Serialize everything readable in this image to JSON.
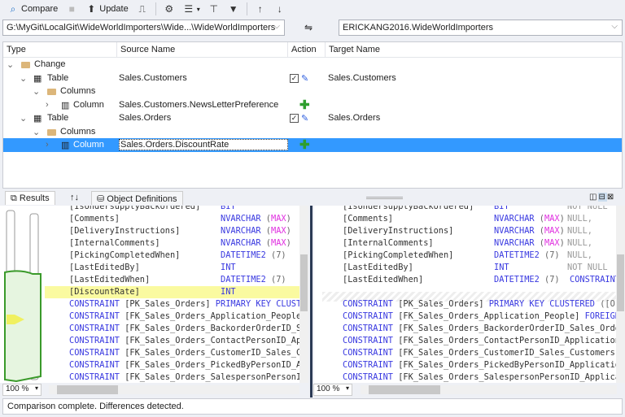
{
  "toolbar": {
    "compare": "Compare",
    "update": "Update"
  },
  "source_path": "G:\\MyGit\\LocalGit\\WideWorldImporters\\Wide...\\WideWorldImporters",
  "target_db": "ERICKANG2016.WideWorldImporters",
  "grid": {
    "headers": [
      "Type",
      "Source Name",
      "Action",
      "Target Name"
    ],
    "rows": [
      {
        "level": 0,
        "expander": "⌄",
        "icon": "folder",
        "type": "Change",
        "source": "",
        "action": "",
        "target": ""
      },
      {
        "level": 1,
        "expander": "⌄",
        "icon": "table",
        "type": "Table",
        "source": "Sales.Customers",
        "action": "edit",
        "target": "Sales.Customers"
      },
      {
        "level": 2,
        "expander": "⌄",
        "icon": "folder",
        "type": "Columns",
        "source": "",
        "action": "",
        "target": ""
      },
      {
        "level": 3,
        "expander": "›",
        "icon": "column",
        "type": "Column",
        "source": "Sales.Customers.NewsLetterPreference",
        "action": "add",
        "target": ""
      },
      {
        "level": 1,
        "expander": "⌄",
        "icon": "table",
        "type": "Table",
        "source": "Sales.Orders",
        "action": "edit",
        "target": "Sales.Orders"
      },
      {
        "level": 2,
        "expander": "⌄",
        "icon": "folder",
        "type": "Columns",
        "source": "",
        "action": "",
        "target": ""
      },
      {
        "level": 3,
        "expander": "›",
        "icon": "column",
        "type": "Column",
        "source": "Sales.Orders.DiscountRate",
        "action": "add",
        "target": "",
        "selected": true
      }
    ]
  },
  "tabs": {
    "results": "Results",
    "sort": "↑↓",
    "object_definitions": "Object Definitions"
  },
  "source_code": [
    [
      [
        "n",
        "[IsUndersupplyBackordered]"
      ],
      [
        "k",
        "BIT"
      ]
    ],
    [
      [
        "n",
        "[Comments]"
      ],
      [
        "k",
        "NVARCHAR "
      ],
      [
        "p",
        "("
      ],
      [
        "m",
        "MAX"
      ],
      [
        "p",
        ")"
      ]
    ],
    [
      [
        "n",
        "[DeliveryInstructions]"
      ],
      [
        "k",
        "NVARCHAR "
      ],
      [
        "p",
        "("
      ],
      [
        "m",
        "MAX"
      ],
      [
        "p",
        ")"
      ]
    ],
    [
      [
        "n",
        "[InternalComments]"
      ],
      [
        "k",
        "NVARCHAR "
      ],
      [
        "p",
        "("
      ],
      [
        "m",
        "MAX"
      ],
      [
        "p",
        ")"
      ]
    ],
    [
      [
        "n",
        "[PickingCompletedWhen]"
      ],
      [
        "k",
        "DATETIME2 "
      ],
      [
        "p",
        "(7)"
      ]
    ],
    [
      [
        "n",
        "[LastEditedBy]"
      ],
      [
        "k",
        "INT"
      ]
    ],
    [
      [
        "n",
        "[LastEditedWhen]"
      ],
      [
        "k",
        "DATETIME2 "
      ],
      [
        "p",
        "(7)"
      ]
    ],
    [
      [
        "n",
        "[DiscountRate]"
      ],
      [
        "k",
        "INT"
      ]
    ],
    [
      [
        "k",
        "CONSTRAINT "
      ],
      [
        "n",
        "[PK_Sales_Orders] "
      ],
      [
        "k",
        "PRIMARY KEY CLUSTERED"
      ]
    ],
    [
      [
        "k",
        "CONSTRAINT "
      ],
      [
        "n",
        "[FK_Sales_Orders_Application_People]"
      ]
    ],
    [
      [
        "k",
        "CONSTRAINT "
      ],
      [
        "n",
        "[FK_Sales_Orders_BackorderOrderID_Sales_Orders]"
      ]
    ],
    [
      [
        "k",
        "CONSTRAINT "
      ],
      [
        "n",
        "[FK_Sales_Orders_ContactPersonID_Application]"
      ]
    ],
    [
      [
        "k",
        "CONSTRAINT "
      ],
      [
        "n",
        "[FK_Sales_Orders_CustomerID_Sales_Customers]"
      ]
    ],
    [
      [
        "k",
        "CONSTRAINT "
      ],
      [
        "n",
        "[FK_Sales_Orders_PickedByPersonID_Application]"
      ]
    ],
    [
      [
        "k",
        "CONSTRAINT "
      ],
      [
        "n",
        "[FK_Sales_Orders_SalespersonPersonID_Application]"
      ]
    ]
  ],
  "target_code": [
    [
      [
        "n",
        "[IsUndersupplyBackordered]"
      ],
      [
        "k",
        "BIT"
      ],
      [
        "g",
        "NOT NULL"
      ]
    ],
    [
      [
        "n",
        "[Comments]"
      ],
      [
        "k",
        "NVARCHAR "
      ],
      [
        "p",
        "("
      ],
      [
        "m",
        "MAX"
      ],
      [
        "p",
        ") "
      ],
      [
        "g",
        "NULL,"
      ]
    ],
    [
      [
        "n",
        "[DeliveryInstructions]"
      ],
      [
        "k",
        "NVARCHAR "
      ],
      [
        "p",
        "("
      ],
      [
        "m",
        "MAX"
      ],
      [
        "p",
        ") "
      ],
      [
        "g",
        "NULL,"
      ]
    ],
    [
      [
        "n",
        "[InternalComments]"
      ],
      [
        "k",
        "NVARCHAR "
      ],
      [
        "p",
        "("
      ],
      [
        "m",
        "MAX"
      ],
      [
        "p",
        ") "
      ],
      [
        "g",
        "NULL,"
      ]
    ],
    [
      [
        "n",
        "[PickingCompletedWhen]"
      ],
      [
        "k",
        "DATETIME2 "
      ],
      [
        "p",
        "(7)  "
      ],
      [
        "g",
        "NULL,"
      ]
    ],
    [
      [
        "n",
        "[LastEditedBy]"
      ],
      [
        "k",
        "INT"
      ],
      [
        "g",
        "NOT NULL"
      ]
    ],
    [
      [
        "n",
        "[LastEditedWhen]"
      ],
      [
        "k",
        "DATETIME2 "
      ],
      [
        "p",
        "(7)  "
      ],
      [
        "k",
        "CONSTRAINT"
      ]
    ],
    [],
    [
      [
        "k",
        "CONSTRAINT "
      ],
      [
        "n",
        "[PK_Sales_Orders] "
      ],
      [
        "k",
        "PRIMARY KEY CLUSTERED "
      ],
      [
        "p",
        "([Or"
      ]
    ],
    [
      [
        "k",
        "CONSTRAINT "
      ],
      [
        "n",
        "[FK_Sales_Orders_Application_People] "
      ],
      [
        "k",
        "FOREIGN"
      ]
    ],
    [
      [
        "k",
        "CONSTRAINT "
      ],
      [
        "n",
        "[FK_Sales_Orders_BackorderOrderID_Sales_Orders]"
      ]
    ],
    [
      [
        "k",
        "CONSTRAINT "
      ],
      [
        "n",
        "[FK_Sales_Orders_ContactPersonID_Application]"
      ]
    ],
    [
      [
        "k",
        "CONSTRAINT "
      ],
      [
        "n",
        "[FK_Sales_Orders_CustomerID_Sales_Customers]"
      ]
    ],
    [
      [
        "k",
        "CONSTRAINT "
      ],
      [
        "n",
        "[FK_Sales_Orders_PickedByPersonID_Application]"
      ]
    ],
    [
      [
        "k",
        "CONSTRAINT "
      ],
      [
        "n",
        "[FK_Sales_Orders_SalespersonPersonID_Application]"
      ]
    ]
  ],
  "zoom_left": "100 %",
  "zoom_right": "100 %",
  "status": "Comparison complete.  Differences detected."
}
